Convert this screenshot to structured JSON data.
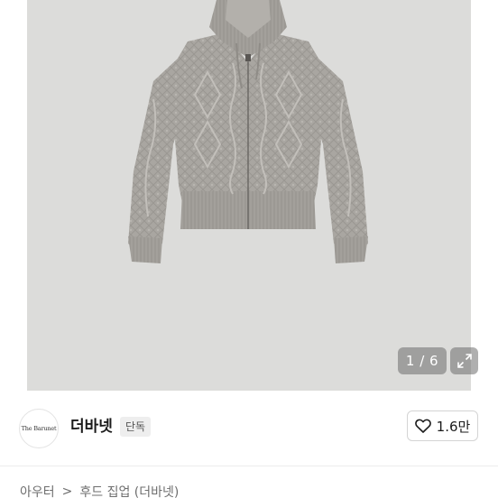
{
  "gallery": {
    "counter": "1 / 6"
  },
  "seller": {
    "avatar_text": "The Barunet",
    "name": "더바넷",
    "badge": "단독"
  },
  "like": {
    "count": "1.6만"
  },
  "breadcrumb": {
    "items": [
      "아우터",
      "후드 집업 (더바넷)"
    ],
    "separator": ">"
  }
}
